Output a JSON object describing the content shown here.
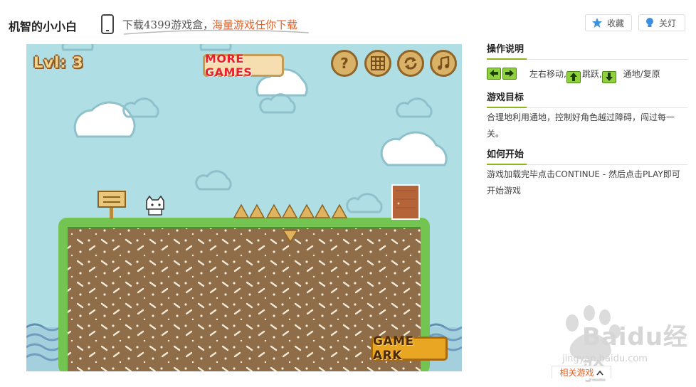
{
  "header": {
    "title": "机智的小小白",
    "promo_download": "下载4399游戏盒，",
    "promo_slogan": "海量游戏任你下载",
    "favorite_label": "收藏",
    "lights_label": "关灯"
  },
  "game": {
    "level_label": "Lvl: 3",
    "more_games_label": "MORE GAMES",
    "help_symbol": "?",
    "game_ark_label": "GAME ARK",
    "icons": [
      "help-icon",
      "level-select-icon",
      "restart-icon",
      "music-icon"
    ]
  },
  "panel": {
    "controls_title": "操作说明",
    "controls_move": "左右移动,",
    "controls_jump": "跳跃,",
    "controls_through": "通地/复原",
    "goal_title": "游戏目标",
    "goal_text": "合理地利用通地，控制好角色越过障碍，闯过每一关。",
    "start_title": "如何开始",
    "start_text": "游戏加载完毕点击CONTINUE - 然后点击PLAY即可开始游戏"
  },
  "footer": {
    "related_label": "相关游戏"
  },
  "watermark": {
    "brand": "Baidu经验",
    "url": "jingyan.baidu.com"
  },
  "colors": {
    "accent_green": "#8bb61f",
    "promo_orange": "#e0622a",
    "sky": "#afdfe5",
    "grass": "#74c452",
    "dirt": "#8e6d48"
  }
}
